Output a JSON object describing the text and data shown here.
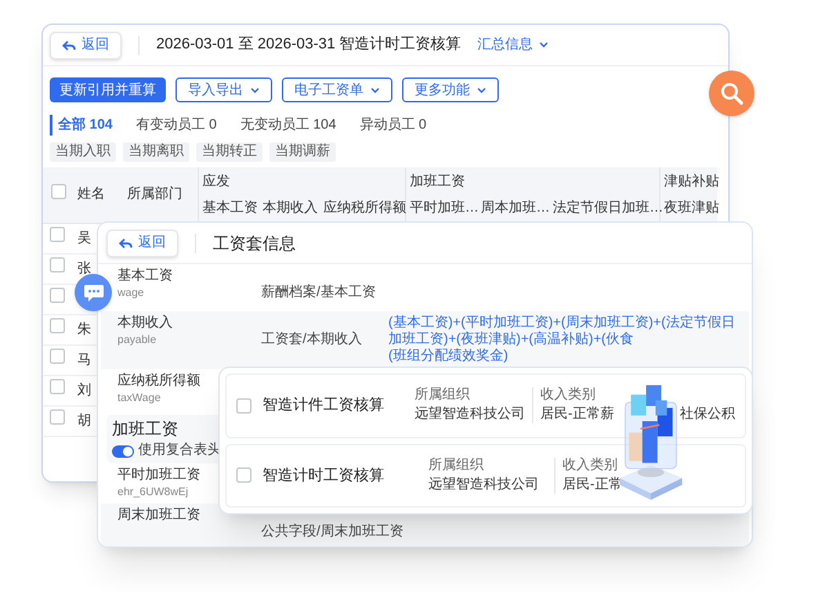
{
  "payroll_window": {
    "back_button": "返回",
    "title": "2026-03-01 至 2026-03-31  智造计时工资核算",
    "summary_menu": "汇总信息",
    "toolbar": [
      {
        "label": "更新引用并重算",
        "kind": "primary"
      },
      {
        "label": "导入导出",
        "kind": "dropdown"
      },
      {
        "label": "电子工资单",
        "kind": "dropdown"
      },
      {
        "label": "更多功能",
        "kind": "dropdown"
      }
    ],
    "filter_tabs": [
      {
        "label": "全部 104",
        "selected": true
      },
      {
        "label": "有变动员工 0",
        "selected": false
      },
      {
        "label": "无变动员工 104",
        "selected": false
      },
      {
        "label": "异动员工 0",
        "selected": false
      }
    ],
    "chips": [
      "当期入职",
      "当期离职",
      "当期转正",
      "当期调薪"
    ],
    "table": {
      "header_checked": false,
      "columns": [
        {
          "label": "姓名"
        },
        {
          "label": "所属部门"
        },
        {
          "label": "应发",
          "children": [
            "基本工资",
            "本期收入",
            "应纳税所得额"
          ]
        },
        {
          "label": "加班工资",
          "children": [
            "平时加班…",
            "周本加班…",
            "法定节假日加班…"
          ]
        },
        {
          "label": "津贴补贴",
          "children": [
            "夜班津贴"
          ]
        }
      ],
      "rows": [
        {
          "name": "吴",
          "checked": false
        },
        {
          "name": "张",
          "checked": false
        },
        {
          "checked": false
        },
        {
          "name": "朱",
          "checked": false
        },
        {
          "name": "马",
          "checked": false
        },
        {
          "name": "刘",
          "checked": false
        },
        {
          "name": "胡",
          "checked": false
        }
      ]
    }
  },
  "salary_set_panel": {
    "back_button": "返回",
    "title": "工资套信息",
    "items": [
      {
        "label": "基本工资",
        "code": "wage",
        "source": "薪酬档案/基本工资"
      },
      {
        "label": "本期收入",
        "code": "payable",
        "source": "工资套/本期收入",
        "formula": [
          "(基本工资)+(平时加班工资)+(周末加班工资)+(法定节假日加班工资)+(夜班津贴)+(高温补贴)+(伙食",
          "(班组分配绩效奖金)"
        ]
      },
      {
        "label": "应纳税所得额",
        "code": "taxWage"
      }
    ],
    "section": {
      "title": "加班工资",
      "toggle": {
        "label": "使用复合表头",
        "on": true
      },
      "items": [
        {
          "label": "平时加班工资",
          "code": "ehr_6UW8wEj"
        },
        {
          "label": "周末加班工资",
          "source": "公共字段/周末加班工资"
        }
      ]
    }
  },
  "payroll_list": [
    {
      "title": "智造计件工资核算",
      "checked": false,
      "org_label": "所属组织",
      "org": "远望智造科技公司",
      "income_label": "收入类别",
      "income": "居民-正常薪",
      "extra": "社保公积"
    },
    {
      "title": "智造计时工资核算",
      "checked": false,
      "org_label": "所属组织",
      "org": "远望智造科技公司",
      "income_label": "收入类别",
      "income": "居民-正常"
    }
  ]
}
